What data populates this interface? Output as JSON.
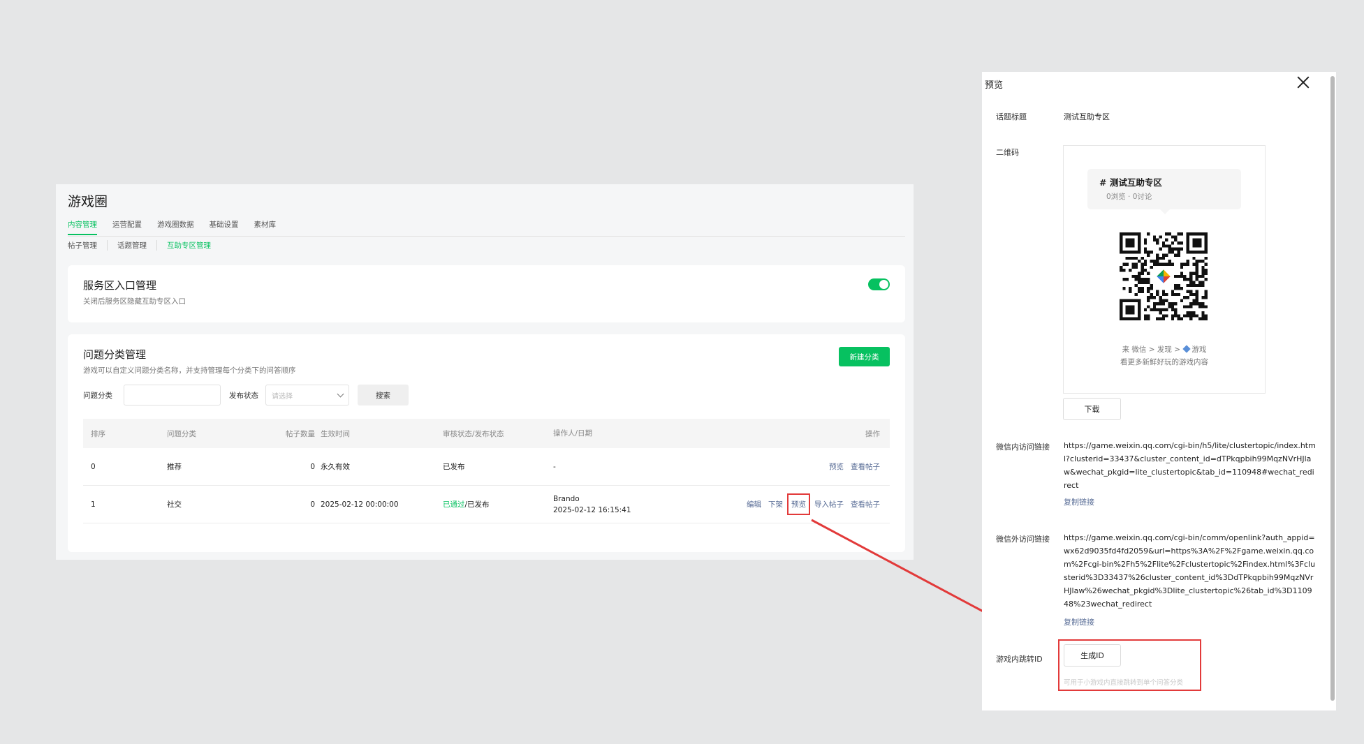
{
  "app": {
    "title": "游戏圈"
  },
  "main_tabs": [
    {
      "label": "内容管理",
      "active": true
    },
    {
      "label": "运营配置",
      "active": false
    },
    {
      "label": "游戏圈数据",
      "active": false
    },
    {
      "label": "基础设置",
      "active": false
    },
    {
      "label": "素材库",
      "active": false
    }
  ],
  "sub_tabs": [
    {
      "label": "帖子管理",
      "active": false
    },
    {
      "label": "话题管理",
      "active": false
    },
    {
      "label": "互助专区管理",
      "active": true
    }
  ],
  "service_card": {
    "title": "服务区入口管理",
    "desc": "关闭后服务区隐藏互助专区入口",
    "toggle_on": true
  },
  "category_card": {
    "title": "问题分类管理",
    "desc": "游戏可以自定义问题分类名称，并支持管理每个分类下的问答顺序",
    "new_button": "新建分类",
    "filter_category_label": "问题分类",
    "filter_status_label": "发布状态",
    "filter_status_placeholder": "请选择",
    "search_button": "搜索"
  },
  "table": {
    "headers": {
      "sort": "排序",
      "category": "问题分类",
      "count": "帖子数量",
      "time": "生效时间",
      "status": "审核状态/发布状态",
      "operator": "操作人/日期",
      "actions": "操作"
    },
    "rows": [
      {
        "sort": "0",
        "category": "推荐",
        "count": "0",
        "time": "永久有效",
        "status": "已发布",
        "operator": "-",
        "operator_date": "",
        "actions": [
          "预览",
          "查看帖子"
        ]
      },
      {
        "sort": "1",
        "category": "社交",
        "count": "0",
        "time": "2025-02-12 00:00:00",
        "status_passed": "已通过",
        "status_sep": "/",
        "status_publish": "已发布",
        "operator": "Brando",
        "operator_date": "2025-02-12 16:15:41",
        "actions": [
          "编辑",
          "下架",
          "预览",
          "导入帖子",
          "查看帖子"
        ]
      }
    ]
  },
  "preview": {
    "title": "预览",
    "topic_label": "话题标题",
    "topic_value": "测试互助专区",
    "qr_label": "二维码",
    "card_topic": "# 测试互助专区",
    "card_stats": "0浏览 · 0讨论",
    "hint_prefix": "来 微信 > 发现 >",
    "hint_game": "游戏",
    "hint_line2": "看更多新鲜好玩的游戏内容",
    "download_button": "下载",
    "in_wechat_label": "微信内访问链接",
    "in_wechat_url": "https://game.weixin.qq.com/cgi-bin/h5/lite/clustertopic/index.html?clusterid=33437&cluster_content_id=dTPkqpbih99MqzNVrHJlaw&wechat_pkgid=lite_clustertopic&tab_id=110948#wechat_redirect",
    "out_wechat_label": "微信外访问链接",
    "out_wechat_url": "https://game.weixin.qq.com/cgi-bin/comm/openlink?auth_appid=wx62d9035fd4fd2059&url=https%3A%2F%2Fgame.weixin.qq.com%2Fcgi-bin%2Fh5%2Flite%2Fclustertopic%2Findex.html%3Fclusterid%3D33437%26cluster_content_id%3DdTPkqpbih99MqzNVrHJlaw%26wechat_pkgid%3Dlite_clustertopic%26tab_id%3D110948%23wechat_redirect",
    "copy_link": "复制链接",
    "jump_id_label": "游戏内跳转ID",
    "generate_button": "生成ID",
    "generate_hint": "可用于小游戏内直接跳转到单个问答分类"
  },
  "colors": {
    "accent": "#07c160",
    "link": "#576b95",
    "annotation": "#e23a3a"
  }
}
